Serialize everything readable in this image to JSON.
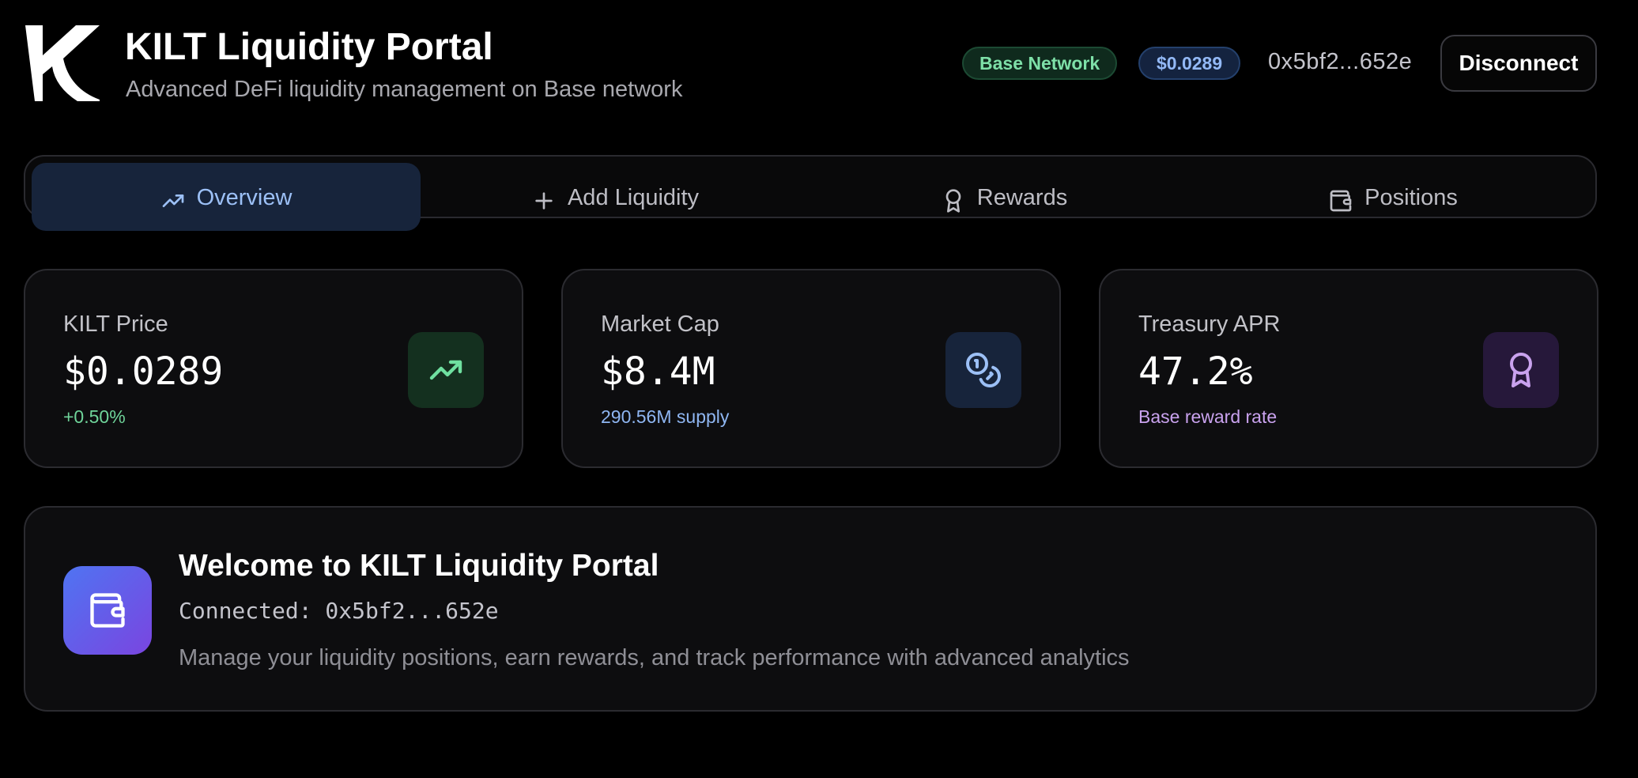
{
  "header": {
    "title": "KILT Liquidity Portal",
    "subtitle": "Advanced DeFi liquidity management on Base network",
    "network_badge": "Base Network",
    "price_badge": "$0.0289",
    "address": "0x5bf2...652e",
    "disconnect_label": "Disconnect"
  },
  "tabs": [
    {
      "label": "Overview",
      "icon": "trending-up-icon",
      "active": true
    },
    {
      "label": "Add Liquidity",
      "icon": "plus-icon",
      "active": false
    },
    {
      "label": "Rewards",
      "icon": "award-icon",
      "active": false
    },
    {
      "label": "Positions",
      "icon": "wallet-icon",
      "active": false
    }
  ],
  "stats": [
    {
      "label": "KILT Price",
      "value": "$0.0289",
      "sub": "+0.50%",
      "icon": "trending-up-icon",
      "sub_color": "#6fd49a",
      "icon_bg": "#14301f",
      "icon_color": "#6fe0a0"
    },
    {
      "label": "Market Cap",
      "value": "$8.4M",
      "sub": "290.56M supply",
      "icon": "coins-icon",
      "sub_color": "#8fb6f2",
      "icon_bg": "#17243b",
      "icon_color": "#9cc0f6"
    },
    {
      "label": "Treasury APR",
      "value": "47.2%",
      "sub": "Base reward rate",
      "icon": "award-icon",
      "sub_color": "#c9a2ee",
      "icon_bg": "#26183a",
      "icon_color": "#c9a2ee"
    }
  ],
  "welcome": {
    "title": "Welcome to KILT Liquidity Portal",
    "connected": "Connected: 0x5bf2...652e",
    "description": "Manage your liquidity positions, earn rewards, and track performance with advanced analytics"
  },
  "colors": {
    "background": "#000000",
    "accent_blue": "#9cc0f6",
    "accent_green": "#6fd49a",
    "accent_purple": "#c9a2ee"
  }
}
